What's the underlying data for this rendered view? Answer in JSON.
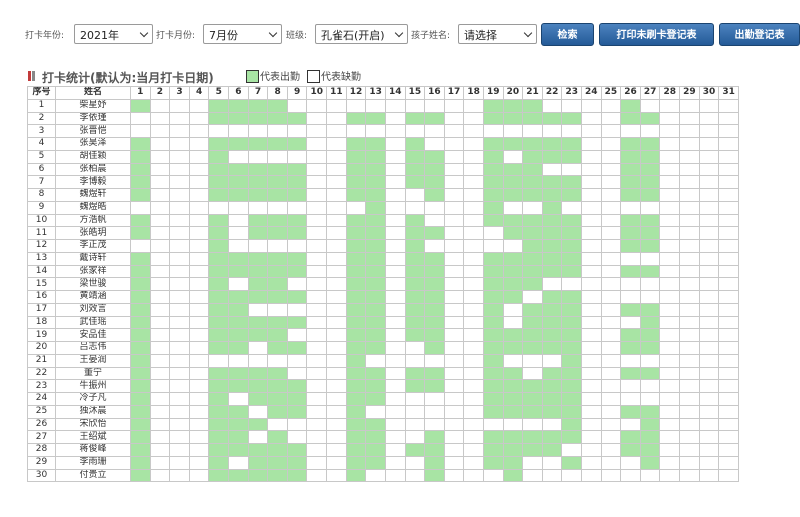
{
  "filters": {
    "year_label": "打卡年份:",
    "year_value": "2021年",
    "month_label": "打卡月份:",
    "month_value": "7月份",
    "class_label": "班级:",
    "class_value": "孔雀石(开启)",
    "child_label": "孩子姓名:",
    "child_value": "请选择"
  },
  "buttons": {
    "search": "检索",
    "print_unswiped": "打印未刷卡登记表",
    "attendance_register": "出勤登记表"
  },
  "section": {
    "title": "打卡统计(默认为:当月打卡日期)",
    "legend_present": "代表出勤",
    "legend_absent": "代表缺勤"
  },
  "colors": {
    "present": "#a8e4a4",
    "absent": "#ffffff",
    "button": "#2e67a6",
    "title_mark_red": "#c23b3b",
    "title_mark_gray": "#888888"
  },
  "table": {
    "col_index": "序号",
    "col_name": "姓名",
    "days": [
      "1",
      "2",
      "3",
      "4",
      "5",
      "6",
      "7",
      "8",
      "9",
      "10",
      "11",
      "12",
      "13",
      "14",
      "15",
      "16",
      "17",
      "18",
      "19",
      "20",
      "21",
      "22",
      "23",
      "24",
      "25",
      "26",
      "27",
      "28",
      "29",
      "30",
      "31"
    ],
    "rows": [
      {
        "no": "1",
        "name": "柴星妤",
        "present": [
          1,
          5,
          6,
          7,
          8,
          19,
          20,
          21,
          26
        ]
      },
      {
        "no": "2",
        "name": "李依瑾",
        "present": [
          5,
          6,
          7,
          8,
          9,
          12,
          13,
          15,
          16,
          19,
          20,
          21,
          22,
          23,
          26,
          27
        ]
      },
      {
        "no": "3",
        "name": "张晋恺",
        "present": []
      },
      {
        "no": "4",
        "name": "张昊泽",
        "present": [
          1,
          5,
          6,
          7,
          8,
          9,
          12,
          13,
          15,
          19,
          20,
          21,
          22,
          23,
          26,
          27
        ]
      },
      {
        "no": "5",
        "name": "胡佳颖",
        "present": [
          1,
          5,
          12,
          13,
          15,
          16,
          19,
          21,
          22,
          23,
          26,
          27
        ]
      },
      {
        "no": "6",
        "name": "张柏晨",
        "present": [
          1,
          5,
          6,
          7,
          8,
          9,
          12,
          13,
          15,
          16,
          19,
          20,
          21,
          26,
          27
        ]
      },
      {
        "no": "7",
        "name": "李博毅",
        "present": [
          1,
          5,
          6,
          7,
          8,
          9,
          12,
          13,
          15,
          16,
          19,
          20,
          21,
          22,
          23,
          26,
          27
        ]
      },
      {
        "no": "8",
        "name": "魏煜轩",
        "present": [
          1,
          5,
          6,
          7,
          8,
          9,
          12,
          13,
          16,
          19,
          20,
          21,
          22,
          23,
          26,
          27
        ]
      },
      {
        "no": "9",
        "name": "魏煜皓",
        "present": [
          13,
          19,
          22
        ]
      },
      {
        "no": "10",
        "name": "方浩帆",
        "present": [
          1,
          5,
          7,
          8,
          9,
          12,
          13,
          15,
          19,
          20,
          21,
          22,
          23,
          26,
          27
        ]
      },
      {
        "no": "11",
        "name": "张皓玥",
        "present": [
          1,
          5,
          7,
          8,
          9,
          12,
          13,
          15,
          16,
          20,
          21,
          22,
          23,
          26,
          27
        ]
      },
      {
        "no": "12",
        "name": "李正茂",
        "present": [
          5,
          12,
          13,
          15,
          21,
          22,
          23,
          26,
          27
        ]
      },
      {
        "no": "13",
        "name": "戴诗轩",
        "present": [
          1,
          5,
          6,
          7,
          8,
          9,
          12,
          13,
          15,
          16,
          19,
          20,
          21,
          22,
          23
        ]
      },
      {
        "no": "14",
        "name": "张家祥",
        "present": [
          1,
          5,
          6,
          7,
          8,
          9,
          12,
          13,
          15,
          16,
          19,
          20,
          21,
          22,
          23,
          26,
          27
        ]
      },
      {
        "no": "15",
        "name": "梁世骏",
        "present": [
          1,
          5,
          7,
          8,
          12,
          13,
          15,
          16,
          19,
          20,
          21
        ]
      },
      {
        "no": "16",
        "name": "黄靖涵",
        "present": [
          1,
          5,
          6,
          7,
          8,
          9,
          12,
          13,
          15,
          16,
          19,
          20,
          22,
          23
        ]
      },
      {
        "no": "17",
        "name": "刘效言",
        "present": [
          1,
          5,
          6,
          12,
          13,
          15,
          16,
          19,
          21,
          22,
          23,
          26,
          27
        ]
      },
      {
        "no": "18",
        "name": "武佳瑶",
        "present": [
          1,
          5,
          6,
          7,
          8,
          9,
          12,
          13,
          15,
          16,
          19,
          21,
          22,
          23,
          27
        ]
      },
      {
        "no": "19",
        "name": "安品佳",
        "present": [
          1,
          5,
          6,
          7,
          8,
          12,
          13,
          15,
          16,
          19,
          20,
          21,
          22,
          23,
          26,
          27
        ]
      },
      {
        "no": "20",
        "name": "吕志伟",
        "present": [
          1,
          5,
          6,
          8,
          9,
          12,
          13,
          16,
          19,
          20,
          21,
          22,
          23,
          26,
          27
        ]
      },
      {
        "no": "21",
        "name": "王晏润",
        "present": [
          1,
          12,
          19,
          23
        ]
      },
      {
        "no": "22",
        "name": "董宁",
        "present": [
          1,
          5,
          6,
          7,
          8,
          12,
          13,
          15,
          16,
          19,
          20,
          22,
          23,
          26,
          27
        ]
      },
      {
        "no": "23",
        "name": "牛振州",
        "present": [
          1,
          5,
          6,
          7,
          8,
          9,
          12,
          13,
          15,
          16,
          19,
          20,
          21,
          22,
          23
        ]
      },
      {
        "no": "24",
        "name": "冷子凡",
        "present": [
          1,
          5,
          7,
          8,
          9,
          12,
          13,
          19,
          20,
          21,
          22,
          23
        ]
      },
      {
        "no": "25",
        "name": "独沐晨",
        "present": [
          1,
          5,
          6,
          8,
          9,
          12,
          19,
          20,
          21,
          22,
          23,
          26,
          27
        ]
      },
      {
        "no": "26",
        "name": "宋欣怡",
        "present": [
          1,
          5,
          6,
          7,
          12,
          13,
          23,
          27
        ]
      },
      {
        "no": "27",
        "name": "王绍斌",
        "present": [
          1,
          5,
          6,
          8,
          12,
          13,
          16,
          19,
          20,
          21,
          22,
          23,
          26,
          27
        ]
      },
      {
        "no": "28",
        "name": "蒋俊峰",
        "present": [
          1,
          5,
          6,
          7,
          8,
          9,
          12,
          13,
          15,
          16,
          19,
          20,
          21,
          22,
          26,
          27
        ]
      },
      {
        "no": "29",
        "name": "李雨珊",
        "present": [
          1,
          5,
          7,
          8,
          9,
          12,
          13,
          16,
          19,
          20,
          23,
          27
        ]
      },
      {
        "no": "30",
        "name": "付贵立",
        "present": [
          1,
          5,
          6,
          7,
          8,
          9,
          12,
          16,
          20
        ]
      }
    ]
  }
}
